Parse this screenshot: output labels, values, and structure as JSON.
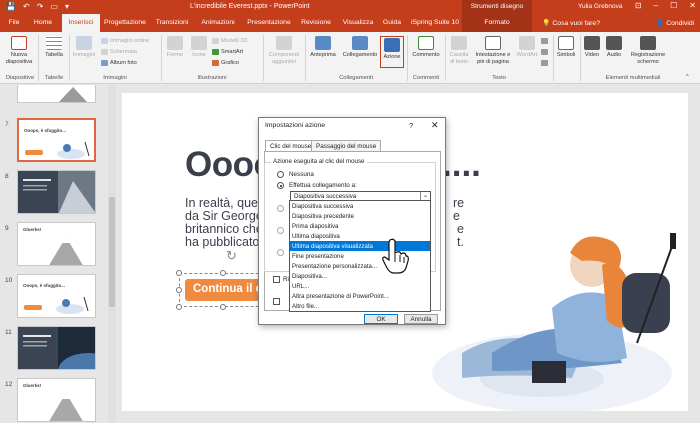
{
  "window": {
    "title": "L'incredibile Everest.pptx  -  PowerPoint",
    "context_label": "Strumenti disegno",
    "user": "Yulia Grebnova"
  },
  "tabs": [
    {
      "label": "File"
    },
    {
      "label": "Home"
    },
    {
      "label": "Inserisci"
    },
    {
      "label": "Progettazione"
    },
    {
      "label": "Transizioni"
    },
    {
      "label": "Animazioni"
    },
    {
      "label": "Presentazione"
    },
    {
      "label": "Revisione"
    },
    {
      "label": "Visualizza"
    },
    {
      "label": "Guida"
    },
    {
      "label": "iSpring Suite 10"
    },
    {
      "label": "Formato"
    }
  ],
  "search": {
    "label": "Cosa vuoi fare?"
  },
  "share": {
    "label": "Condividi"
  },
  "ribbon": {
    "nuova_line1": "Nuova",
    "nuova_line2": "diapositiva",
    "tabella": "Tabella",
    "immagini": "Immagini",
    "immagini_online": "Immagini online",
    "schermata": "Schermata",
    "album_foto": "Album foto",
    "forme": "Forme",
    "icone": "Icone",
    "modelli_3d": "Modelli 3D",
    "smartart": "SmartArt",
    "grafico": "Grafico",
    "componenti_line1": "Componenti",
    "componenti_line2": "aggiuntivi",
    "anteprima": "Anteprima",
    "collegamento": "Collegamento",
    "azione": "Azione",
    "commento": "Commento",
    "casella_line1": "Casella",
    "casella_line2": "di testo",
    "intestazione_line1": "Intestazione e",
    "intestazione_line2": "piè di pagina",
    "wordart": "WordArt",
    "simboli": "Simboli",
    "video": "Video",
    "audio": "Audio",
    "registrazione_line1": "Registrazione",
    "registrazione_line2": "schermo",
    "groups": {
      "diapositive": "Diapositive",
      "tabelle": "Tabelle",
      "immagini": "Immagini",
      "illustrazioni": "Illustrazioni",
      "collegamenti": "Collegamenti",
      "commenti": "Commenti",
      "testo": "Testo",
      "multimediali": "Elementi multimediali"
    }
  },
  "thumbnails": [
    {
      "num": "7",
      "text": "Ooops, è sfuggito..."
    },
    {
      "num": "8",
      "text": ""
    },
    {
      "num": "9",
      "text": "Gluerks!"
    },
    {
      "num": "10",
      "text": "Ooops, è sfuggito..."
    },
    {
      "num": "11",
      "text": ""
    },
    {
      "num": "12",
      "text": "Gluerks!"
    }
  ],
  "slide": {
    "title": "Oooops",
    "title_dots": "....",
    "body_lines": [
      "In realtà, quest",
      "da Sir George E",
      "britannico che",
      "ha pubblicato p"
    ],
    "body_right": [
      "re",
      "e",
      "e",
      "t."
    ],
    "button_text": "Continua il quiz"
  },
  "dialog": {
    "title": "Impostazioni azione",
    "help": "?",
    "close": "✕",
    "tab_click": "Clic del mouse",
    "tab_hover": "Passaggio del mouse",
    "legend": "Azione eseguita al clic del mouse",
    "opt_nessuna": "Nessuna",
    "opt_collegamento": "Effettua collegamento a:",
    "combo_value": "Diapositiva successiva",
    "check_label": "Ri",
    "ok": "OK",
    "cancel": "Annulla"
  },
  "dropdown": {
    "items": [
      "Diapositiva successiva",
      "Diapositiva precedente",
      "Prima diapositiva",
      "Ultima diapositiva",
      "Ultima diapositiva visualizzata",
      "Fine presentazione",
      "Presentazione personalizzata...",
      "Diapositiva...",
      "URL...",
      "Altra presentazione di PowerPoint...",
      "Altro file..."
    ],
    "highlighted_index": 4
  },
  "colors": {
    "accent": "#c43e1c",
    "button": "#f08a3e",
    "highlight": "#0078d7"
  }
}
